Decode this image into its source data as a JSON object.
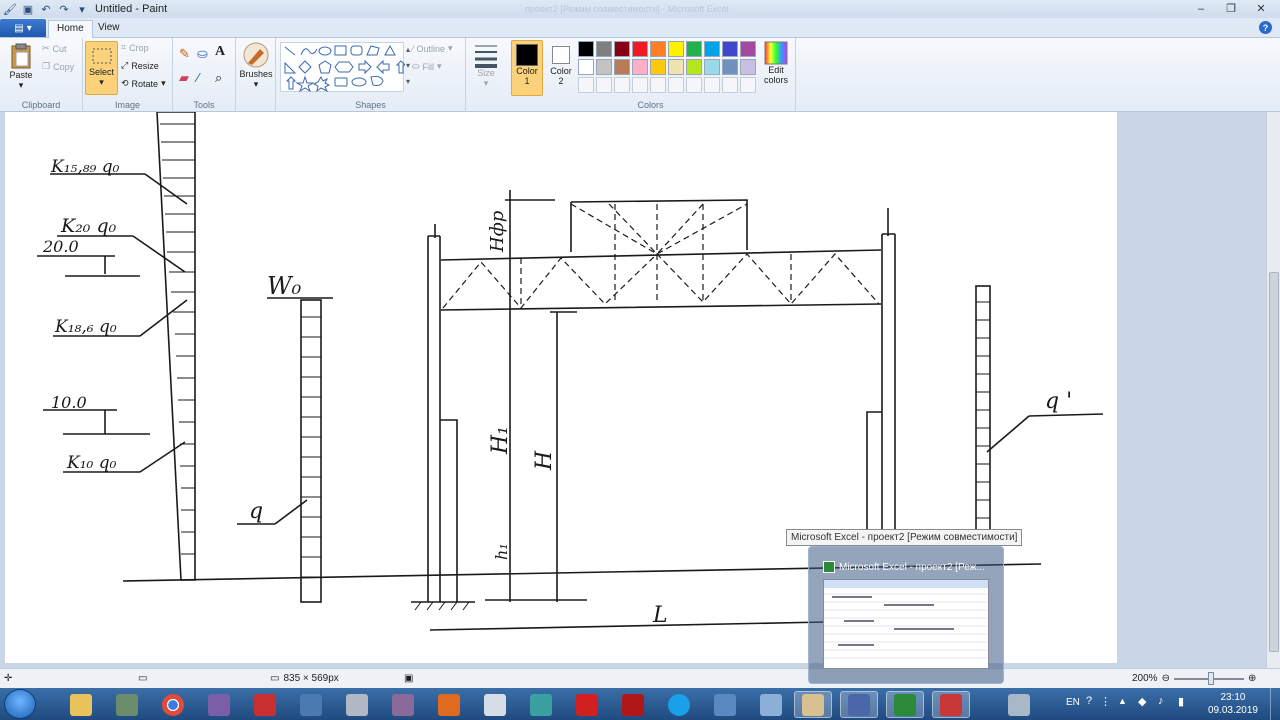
{
  "window": {
    "title": "Untitled - Paint",
    "ghost_title": "проект2  [Режим совместимости]  - Microsoft Excel"
  },
  "ribbon": {
    "tabs": [
      "Home",
      "View"
    ],
    "clipboard": {
      "paste": "Paste",
      "cut": "Cut",
      "copy": "Copy",
      "label": "Clipboard"
    },
    "image": {
      "select": "Select",
      "crop": "Crop",
      "resize": "Resize",
      "rotate": "Rotate",
      "label": "Image"
    },
    "tools": {
      "label": "Tools"
    },
    "brushes": {
      "label": "Brushes"
    },
    "shapes": {
      "outline": "Outline",
      "fill": "Fill",
      "label": "Shapes"
    },
    "size": {
      "label": "Size"
    },
    "color1": {
      "label": "Color",
      "num": "1"
    },
    "color2": {
      "label": "Color",
      "num": "2"
    },
    "colors": {
      "label": "Colors",
      "edit_line1": "Edit",
      "edit_line2": "colors",
      "palette_row1": [
        "#000000",
        "#7f7f7f",
        "#880015",
        "#ed1c24",
        "#ff7f27",
        "#fff200",
        "#22b14c",
        "#00a2e8",
        "#3f48cc",
        "#a349a4"
      ],
      "palette_row2": [
        "#ffffff",
        "#c3c3c3",
        "#b97a57",
        "#ffaec9",
        "#ffc90e",
        "#efe4b0",
        "#b5e61d",
        "#99d9ea",
        "#7092be",
        "#c8bfe7"
      ]
    }
  },
  "drawing": {
    "labels": {
      "k1589": "K₁₅,₈₉ q₀",
      "k20": "K₂₀ q₀",
      "v20": "20.0",
      "k186": "K₁₈,₆ q₀",
      "v10": "10.0",
      "k10": "K₁₀ q₀",
      "w0": "W₀",
      "q": "q",
      "q_prime": "q '",
      "h_fr": "Hфр",
      "h1": "H₁",
      "h": "H",
      "h_small": "h₁",
      "L": "L"
    }
  },
  "status": {
    "dimensions": "835 × 569px",
    "zoom": "200%"
  },
  "tooltip": "Microsoft Excel - проект2  [Режим совместимости]",
  "preview": {
    "title": "Microsoft Excel - проект2  [Реж..."
  },
  "taskbar": {
    "lang": "EN",
    "time": "23:10",
    "date": "09.03.2019"
  }
}
